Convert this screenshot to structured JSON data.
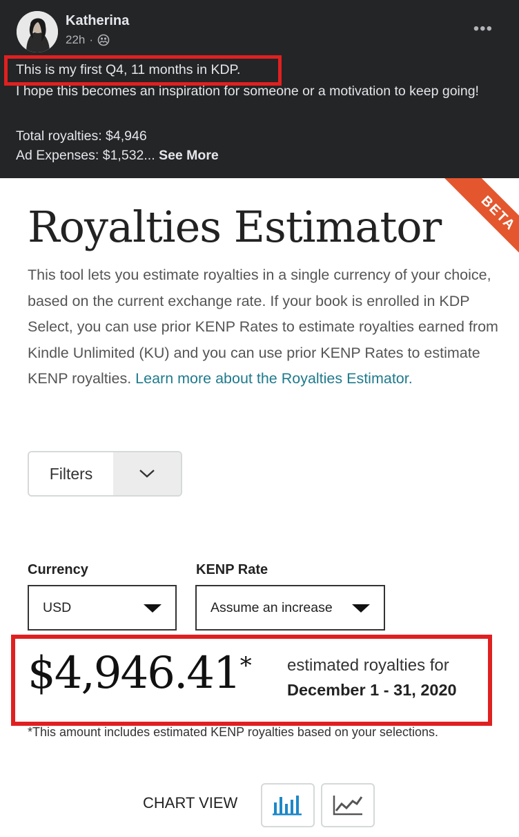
{
  "post": {
    "author": "Katherina",
    "time": "22h",
    "separator": "·",
    "privacy_icon": "friends-icon",
    "more_icon": "more-horizontal-icon",
    "more_label": "•••",
    "line1": "This is my first Q4, 11 months in KDP.",
    "line2": "I hope this becomes an inspiration for someone or a motivation to keep going!",
    "royalties": "Total royalties: $4,946",
    "ads": "Ad Expenses: $1,532...",
    "see_more": "See More"
  },
  "estimator": {
    "beta": "BETA",
    "title": "Royalties Estimator",
    "description": "This tool lets you estimate royalties in a single currency of your choice, based on the current exchange rate. If your book is enrolled in KDP Select, you can use prior KENP Rates to estimate royalties earned from Kindle Unlimited (KU) and you can use prior KENP Rates to estimate KENP royalties.",
    "learn_more": "Learn more about the Royalties Estimator.",
    "filters_label": "Filters",
    "currency_label": "Currency",
    "currency_value": "USD",
    "kenp_label": "KENP Rate",
    "kenp_value": "Assume an increase",
    "amount": "$4,946.41",
    "asterisk": "*",
    "estimated_label": "estimated royalties for",
    "date_range": "December 1 - 31, 2020",
    "footnote": "*This amount includes estimated KENP royalties based on your selections.",
    "chart_view_label": "CHART VIEW",
    "bar_chart_icon": "bar-chart-icon",
    "line_chart_icon": "line-chart-icon"
  },
  "colors": {
    "post_bg": "#242526",
    "highlight": "#e02020",
    "beta": "#e4572e",
    "link": "#1e7a8c",
    "bar_icon": "#1e88c8"
  }
}
